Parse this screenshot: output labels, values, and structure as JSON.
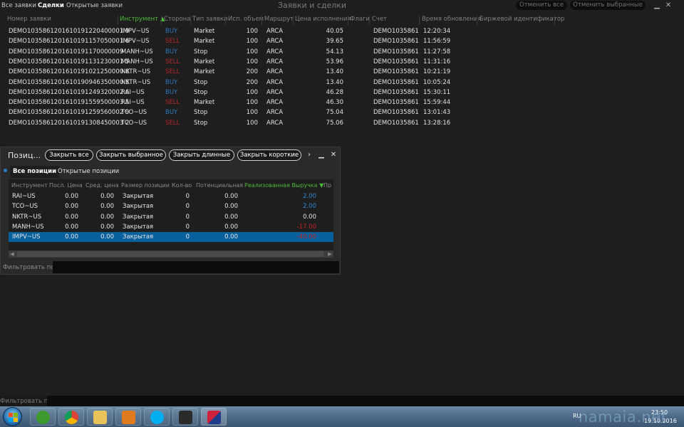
{
  "top_tabs": [
    {
      "label": "Все заявки",
      "active": false
    },
    {
      "label": "Сделки",
      "active": true
    },
    {
      "label": "Открытые заявки",
      "active": false
    }
  ],
  "window_title": "Заявки и сделки",
  "top_buttons": {
    "cancel_all": "Отменить все",
    "cancel_selected": "Отменить выбранные"
  },
  "window_controls": {
    "minimize": "▁",
    "close": "✕"
  },
  "orders": {
    "columns": [
      "Номер заявки",
      "Инструмент ▲",
      "Сторона",
      "Тип заявки",
      "Исп. объем",
      "Маршрут",
      "Цена исполнения",
      "Флаги",
      "Счет",
      "Время обновления",
      "Биржевой идентификатор"
    ],
    "rows": [
      {
        "id": "DEMO1035861201610191220400001 9",
        "instrument": "IMPV~US",
        "side": "BUY",
        "type": "Market",
        "volume": "100",
        "route": "ARCA",
        "price": "40.05",
        "account": "DEMO1035861",
        "time": "12:20:34"
      },
      {
        "id": "DEMO1035861201610191157050001 6",
        "instrument": "IMPV~US",
        "side": "SELL",
        "type": "Market",
        "volume": "100",
        "route": "ARCA",
        "price": "39.65",
        "account": "DEMO1035861",
        "time": "11:56:59"
      },
      {
        "id": "DEMO1035861201610191170000009",
        "instrument": "MANH~US",
        "side": "BUY",
        "type": "Stop",
        "volume": "100",
        "route": "ARCA",
        "price": "54.13",
        "account": "DEMO1035861",
        "time": "11:27:58"
      },
      {
        "id": "DEMO1035861201610191131230001 5",
        "instrument": "MANH~US",
        "side": "SELL",
        "type": "Market",
        "volume": "100",
        "route": "ARCA",
        "price": "53.96",
        "account": "DEMO1035861",
        "time": "11:31:16"
      },
      {
        "id": "DEMO1035861201610191021250000 8",
        "instrument": "NKTR~US",
        "side": "SELL",
        "type": "Market",
        "volume": "200",
        "route": "ARCA",
        "price": "13.40",
        "account": "DEMO1035861",
        "time": "10:21:19"
      },
      {
        "id": "DEMO1035861201610190946350000 5",
        "instrument": "NKTR~US",
        "side": "BUY",
        "type": "Stop",
        "volume": "200",
        "route": "ARCA",
        "price": "13.40",
        "account": "DEMO1035861",
        "time": "10:05:24"
      },
      {
        "id": "DEMO1035861201610191249320002 6",
        "instrument": "RAI~US",
        "side": "BUY",
        "type": "Stop",
        "volume": "100",
        "route": "ARCA",
        "price": "46.28",
        "account": "DEMO1035861",
        "time": "15:30:11"
      },
      {
        "id": "DEMO1035861201610191559500003 5",
        "instrument": "RAI~US",
        "side": "SELL",
        "type": "Market",
        "volume": "100",
        "route": "ARCA",
        "price": "46.30",
        "account": "DEMO1035861",
        "time": "15:59:44"
      },
      {
        "id": "DEMO1035861201610191259560002 9",
        "instrument": "TCO~US",
        "side": "BUY",
        "type": "Stop",
        "volume": "100",
        "route": "ARCA",
        "price": "75.04",
        "account": "DEMO1035861",
        "time": "13:01:43"
      },
      {
        "id": "DEMO1035861201610191308450003 2",
        "instrument": "TCO~US",
        "side": "SELL",
        "type": "Stop",
        "volume": "100",
        "route": "ARCA",
        "price": "75.06",
        "account": "DEMO1035861",
        "time": "13:28:16"
      }
    ]
  },
  "positions": {
    "title": "Позиц...",
    "buttons": [
      "Закрыть все",
      "Закрыть выбранное",
      "Закрыть длинные",
      "Закрыть короткие"
    ],
    "more": "›",
    "controls": {
      "minimize": "▁",
      "close": "✕"
    },
    "tabs": [
      "Все позиции",
      "Открытые позиции"
    ],
    "columns": [
      "Инструмент",
      "Посл. Цена",
      "Сред. цена",
      "Размер позиции",
      "Кол-во",
      "Потенциальная",
      "Реализованная Выручка ▼",
      "Пр"
    ],
    "rows": [
      {
        "instrument": "RAI~US",
        "last": "0.00",
        "avg": "0.00",
        "size": "Закрытая",
        "qty": "0",
        "potential": "0.00",
        "realized": "2.00",
        "sign": "pos",
        "selected": false
      },
      {
        "instrument": "TCO~US",
        "last": "0.00",
        "avg": "0.00",
        "size": "Закрытая",
        "qty": "0",
        "potential": "0.00",
        "realized": "2.00",
        "sign": "pos",
        "selected": false
      },
      {
        "instrument": "NKTR~US",
        "last": "0.00",
        "avg": "0.00",
        "size": "Закрытая",
        "qty": "0",
        "potential": "0.00",
        "realized": "0.00",
        "sign": "zero",
        "selected": false
      },
      {
        "instrument": "MANH~US",
        "last": "0.00",
        "avg": "0.00",
        "size": "Закрытая",
        "qty": "0",
        "potential": "0.00",
        "realized": "-17.00",
        "sign": "neg",
        "selected": false
      },
      {
        "instrument": "IMPV~US",
        "last": "0.00",
        "avg": "0.00",
        "size": "Закрытая",
        "qty": "0",
        "potential": "0.00",
        "realized": "-40.00",
        "sign": "neg",
        "selected": true
      }
    ],
    "filter_label": "Фильтровать по"
  },
  "bottom_filter_label": "Фильтровать по",
  "taskbar": {
    "language": "RU",
    "time": "23:50",
    "date": "19.10.2016",
    "watermark": "namaia.net"
  }
}
